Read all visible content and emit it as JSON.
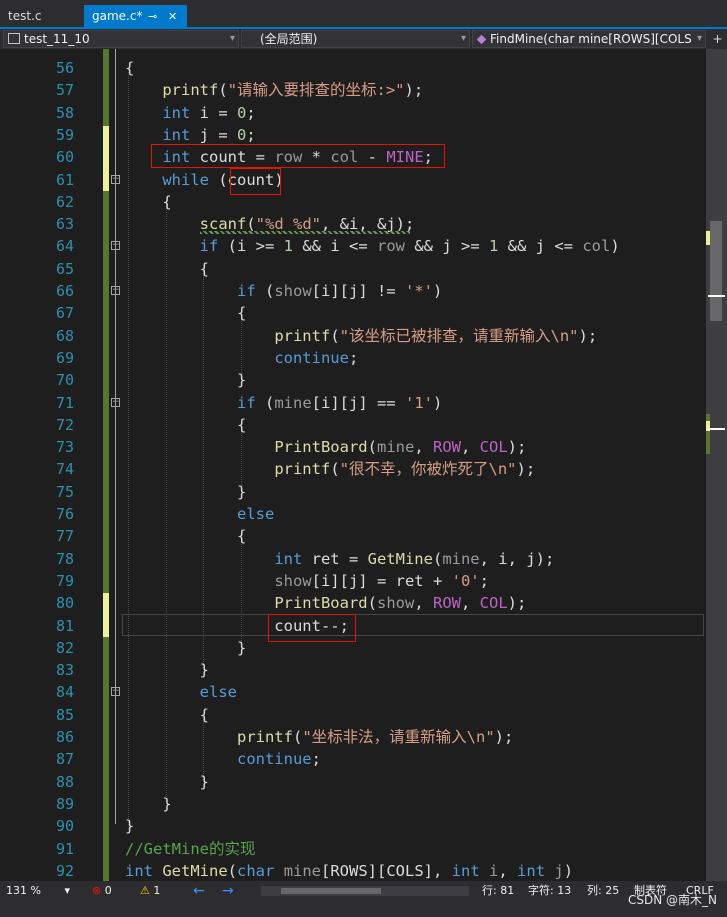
{
  "tabs": [
    {
      "label": "test.c",
      "active": false
    },
    {
      "label": "game.c*",
      "active": true,
      "pin": "⊸",
      "close": "✕"
    }
  ],
  "nav": {
    "project": "test_11_10",
    "scope": "(全局范围)",
    "function": "FindMine(char mine[ROWS][COLS",
    "split": "+"
  },
  "lines": [
    {
      "n": "56",
      "t": [
        [
          "{",
          ""
        ]
      ]
    },
    {
      "n": "57",
      "t": [
        [
          "    ",
          ""
        ],
        [
          "printf",
          "f"
        ],
        [
          "(",
          ""
        ],
        [
          "\"请输入要排查的坐标:>\"",
          "s"
        ],
        [
          ");",
          ""
        ]
      ]
    },
    {
      "n": "58",
      "t": [
        [
          "    ",
          ""
        ],
        [
          "int",
          "k"
        ],
        [
          " i = ",
          ""
        ],
        [
          "0",
          "n"
        ],
        [
          ";",
          ""
        ]
      ]
    },
    {
      "n": "59",
      "t": [
        [
          "    ",
          ""
        ],
        [
          "int",
          "k"
        ],
        [
          " j = ",
          ""
        ],
        [
          "0",
          "n"
        ],
        [
          ";",
          ""
        ]
      ]
    },
    {
      "n": "60",
      "t": [
        [
          "    ",
          ""
        ],
        [
          "int",
          "k"
        ],
        [
          " count = ",
          ""
        ],
        [
          "row",
          "p"
        ],
        [
          " * ",
          ""
        ],
        [
          "col",
          "p"
        ],
        [
          " - ",
          ""
        ],
        [
          "MINE",
          "m"
        ],
        [
          ";",
          ""
        ]
      ]
    },
    {
      "n": "61",
      "t": [
        [
          "    ",
          ""
        ],
        [
          "while",
          "k"
        ],
        [
          " (count)",
          ""
        ]
      ]
    },
    {
      "n": "62",
      "t": [
        [
          "    {",
          ""
        ]
      ]
    },
    {
      "n": "63",
      "t": [
        [
          "        ",
          ""
        ],
        [
          "scanf",
          "f"
        ],
        [
          "(",
          ""
        ],
        [
          "\"%d %d\"",
          "s"
        ],
        [
          ", &i, &j);",
          ""
        ]
      ]
    },
    {
      "n": "64",
      "t": [
        [
          "        ",
          ""
        ],
        [
          "if",
          "k"
        ],
        [
          " (i >= ",
          ""
        ],
        [
          "1",
          "n"
        ],
        [
          " && i <= ",
          ""
        ],
        [
          "row",
          "p"
        ],
        [
          " && j >= ",
          ""
        ],
        [
          "1",
          "n"
        ],
        [
          " && j <= ",
          ""
        ],
        [
          "col",
          "p"
        ],
        [
          ")",
          ""
        ]
      ]
    },
    {
      "n": "65",
      "t": [
        [
          "        {",
          ""
        ]
      ]
    },
    {
      "n": "66",
      "t": [
        [
          "            ",
          ""
        ],
        [
          "if",
          "k"
        ],
        [
          " (",
          ""
        ],
        [
          "show",
          "p"
        ],
        [
          "[i][j] != ",
          ""
        ],
        [
          "'*'",
          "s"
        ],
        [
          ")",
          ""
        ]
      ]
    },
    {
      "n": "67",
      "t": [
        [
          "            {",
          ""
        ]
      ]
    },
    {
      "n": "68",
      "t": [
        [
          "                ",
          ""
        ],
        [
          "printf",
          "f"
        ],
        [
          "(",
          ""
        ],
        [
          "\"该坐标已被排查，请重新输入\\n\"",
          "s"
        ],
        [
          ");",
          ""
        ]
      ]
    },
    {
      "n": "69",
      "t": [
        [
          "                ",
          ""
        ],
        [
          "continue",
          "k"
        ],
        [
          ";",
          ""
        ]
      ]
    },
    {
      "n": "70",
      "t": [
        [
          "            }",
          ""
        ]
      ]
    },
    {
      "n": "71",
      "t": [
        [
          "            ",
          ""
        ],
        [
          "if",
          "k"
        ],
        [
          " (",
          ""
        ],
        [
          "mine",
          "p"
        ],
        [
          "[i][j] == ",
          ""
        ],
        [
          "'1'",
          "s"
        ],
        [
          ")",
          ""
        ]
      ]
    },
    {
      "n": "72",
      "t": [
        [
          "            {",
          ""
        ]
      ]
    },
    {
      "n": "73",
      "t": [
        [
          "                ",
          ""
        ],
        [
          "PrintBoard",
          "f"
        ],
        [
          "(",
          ""
        ],
        [
          "mine",
          "p"
        ],
        [
          ", ",
          ""
        ],
        [
          "ROW",
          "m"
        ],
        [
          ", ",
          ""
        ],
        [
          "COL",
          "m"
        ],
        [
          ");",
          ""
        ]
      ]
    },
    {
      "n": "74",
      "t": [
        [
          "                ",
          ""
        ],
        [
          "printf",
          "f"
        ],
        [
          "(",
          ""
        ],
        [
          "\"很不幸，你被炸死了\\n\"",
          "s"
        ],
        [
          ");",
          ""
        ]
      ]
    },
    {
      "n": "75",
      "t": [
        [
          "            }",
          ""
        ]
      ]
    },
    {
      "n": "76",
      "t": [
        [
          "            ",
          ""
        ],
        [
          "else",
          "k"
        ]
      ]
    },
    {
      "n": "77",
      "t": [
        [
          "            {",
          ""
        ]
      ]
    },
    {
      "n": "78",
      "t": [
        [
          "                ",
          ""
        ],
        [
          "int",
          "k"
        ],
        [
          " ret = ",
          ""
        ],
        [
          "GetMine",
          "f"
        ],
        [
          "(",
          ""
        ],
        [
          "mine",
          "p"
        ],
        [
          ", i, j);",
          ""
        ]
      ]
    },
    {
      "n": "79",
      "t": [
        [
          "                ",
          ""
        ],
        [
          "show",
          "p"
        ],
        [
          "[i][j] = ret + ",
          ""
        ],
        [
          "'0'",
          "s"
        ],
        [
          ";",
          ""
        ]
      ]
    },
    {
      "n": "80",
      "t": [
        [
          "                ",
          ""
        ],
        [
          "PrintBoard",
          "f"
        ],
        [
          "(",
          ""
        ],
        [
          "show",
          "p"
        ],
        [
          ", ",
          ""
        ],
        [
          "ROW",
          "m"
        ],
        [
          ", ",
          ""
        ],
        [
          "COL",
          "m"
        ],
        [
          ");",
          ""
        ]
      ]
    },
    {
      "n": "81",
      "t": [
        [
          "                count--;",
          ""
        ]
      ]
    },
    {
      "n": "82",
      "t": [
        [
          "            }",
          ""
        ]
      ]
    },
    {
      "n": "83",
      "t": [
        [
          "        }",
          ""
        ]
      ]
    },
    {
      "n": "84",
      "t": [
        [
          "        ",
          ""
        ],
        [
          "else",
          "k"
        ]
      ]
    },
    {
      "n": "85",
      "t": [
        [
          "        {",
          ""
        ]
      ]
    },
    {
      "n": "86",
      "t": [
        [
          "            ",
          ""
        ],
        [
          "printf",
          "f"
        ],
        [
          "(",
          ""
        ],
        [
          "\"坐标非法，请重新输入\\n\"",
          "s"
        ],
        [
          ");",
          ""
        ]
      ]
    },
    {
      "n": "87",
      "t": [
        [
          "            ",
          ""
        ],
        [
          "continue",
          "k"
        ],
        [
          ";",
          ""
        ]
      ]
    },
    {
      "n": "88",
      "t": [
        [
          "        }",
          ""
        ]
      ]
    },
    {
      "n": "89",
      "t": [
        [
          "    }",
          ""
        ]
      ]
    },
    {
      "n": "90",
      "t": [
        [
          "}",
          ""
        ]
      ]
    },
    {
      "n": "91",
      "t": [
        [
          "//GetMine的实现",
          "c"
        ]
      ]
    },
    {
      "n": "92",
      "t": [
        [
          "int",
          "k"
        ],
        [
          " ",
          ""
        ],
        [
          "GetMine",
          "f"
        ],
        [
          "(",
          ""
        ],
        [
          "char",
          "k"
        ],
        [
          " ",
          ""
        ],
        [
          "mine",
          "p"
        ],
        [
          "[ROWS][COLS], ",
          ""
        ],
        [
          "int",
          "k"
        ],
        [
          " ",
          ""
        ],
        [
          "i",
          "p"
        ],
        [
          ", ",
          ""
        ],
        [
          "int",
          "k"
        ],
        [
          " ",
          ""
        ],
        [
          "j",
          "p"
        ],
        [
          ")",
          ""
        ]
      ]
    }
  ],
  "status": {
    "zoom": "131 %",
    "errors": "0",
    "warnings": "1",
    "line": "行: 81",
    "char": "字符: 13",
    "col": "列: 25",
    "tabs": "制表符",
    "eol": "CRLF"
  },
  "watermark": "CSDN @南木_N"
}
